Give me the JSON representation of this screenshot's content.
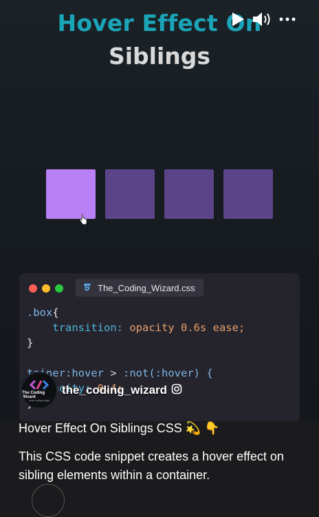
{
  "video": {
    "title_line1": "Hover Effect On",
    "title_line2": "Siblings",
    "controls": {
      "play_icon": "play-icon",
      "volume_icon": "volume-icon",
      "more_icon": "more-icon"
    },
    "boxes": {
      "count": 4,
      "active_index": 0,
      "active_color": "#b97ff5",
      "dim_color": "#5c4489"
    },
    "code": {
      "window_dots": [
        "#ff5f57",
        "#febc2e",
        "#28c840"
      ],
      "filename": "The_Coding_Wizard.css",
      "line1_selector": ".box",
      "line1_brace": "{",
      "line2_prop": "transition:",
      "line2_value": "opacity",
      "line2_num": "0.6s",
      "line2_ease": "ease;",
      "line3": "}",
      "line5_selector": "tainer:hover",
      "line5_op": ">",
      "line5_rest": ":not(:hover) {",
      "line6_prop": "opacity:",
      "line6_val": "0.4;",
      "line7": "}"
    },
    "channel": {
      "name": "the_coding_wizard",
      "avatar_text": "The Coding Wizard",
      "avatar_sub": "Learn coding magic"
    }
  },
  "post": {
    "title": "Hover Effect On Siblings CSS 💫 👇",
    "description": "This CSS code snippet creates a hover effect on sibling elements within a container."
  }
}
